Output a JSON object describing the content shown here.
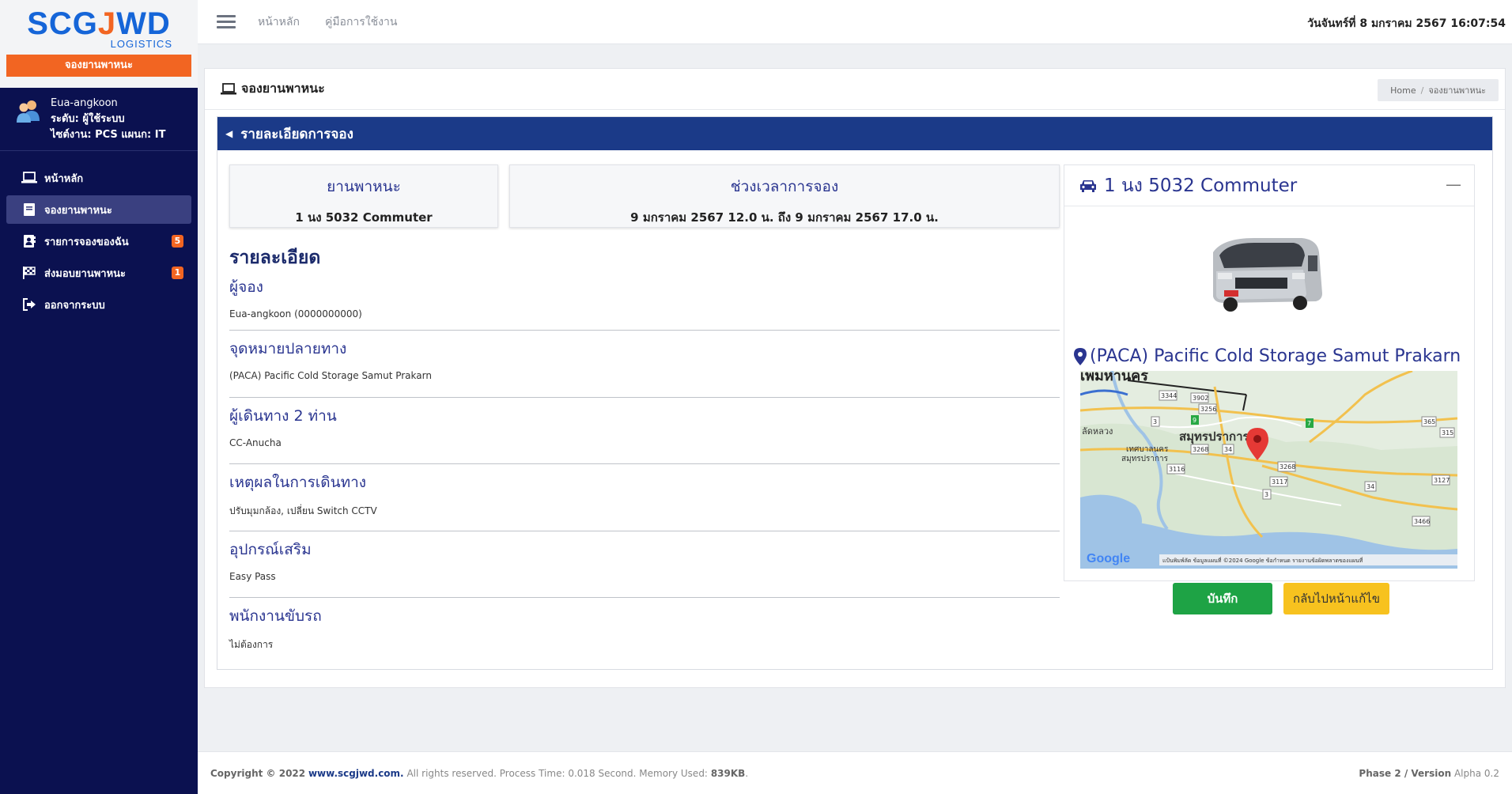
{
  "sidebar": {
    "logo_main": "SCGJWD",
    "logo_sub": "LOGISTICS",
    "logo_banner": "จองยานพาหนะ",
    "user": {
      "name": "Eua-angkoon",
      "role": "ระดับ: ผู้ใช้ระบบ",
      "site": "ไซต์งาน: PCS แผนก: IT"
    },
    "items": [
      {
        "label": "หน้าหลัก",
        "icon": "laptop-icon"
      },
      {
        "label": "จองยานพาหนะ",
        "icon": "book-icon",
        "active": true
      },
      {
        "label": "รายการจองของฉัน",
        "icon": "contact-book-icon",
        "badge": "5"
      },
      {
        "label": "ส่งมอบยานพาหนะ",
        "icon": "flag-checkered-icon",
        "badge": "1"
      },
      {
        "label": "ออกจากระบบ",
        "icon": "sign-out-icon"
      }
    ]
  },
  "topbar": {
    "links": [
      "หน้าหลัก",
      "คู่มือการใช้งาน"
    ],
    "datetime": "วันจันทร์ที่ 8 มกราคม 2567  16:07:54"
  },
  "page": {
    "title": "จองยานพาหนะ",
    "breadcrumb": [
      "Home",
      "จองยานพาหนะ"
    ]
  },
  "panel": {
    "header": "รายละเอียดการจอง",
    "vehicle_box": {
      "label": "ยานพาหนะ",
      "value": "1 นง 5032 Commuter"
    },
    "time_box": {
      "label": "ช่วงเวลาการจอง",
      "value": "9 มกราคม 2567 12.0 น. ถึง 9 มกราคม 2567 17.0 น."
    },
    "details_title": "รายละเอียด",
    "fields": [
      {
        "label": "ผู้จอง",
        "value": "Eua-angkoon (0000000000)"
      },
      {
        "label": "จุดหมายปลายทาง",
        "value": "(PACA) Pacific Cold Storage Samut Prakarn"
      },
      {
        "label": "ผู้เดินทาง 2 ท่าน",
        "value": "CC-Anucha"
      },
      {
        "label": "เหตุผลในการเดินทาง",
        "value": "ปรับมุมกล้อง, เปลี่ยน Switch CCTV"
      },
      {
        "label": "อุปกรณ์เสริม",
        "value": "Easy Pass"
      },
      {
        "label": "พนักงานขับรถ",
        "value": "ไม่ต้องการ"
      }
    ],
    "vehicle_card": {
      "title": "1 นง 5032 Commuter",
      "destination": "(PACA) Pacific Cold Storage Samut Prakarn",
      "map": {
        "city_label_top": "เพมหานคร",
        "city_label_main": "สมุทรปราการ",
        "town_label_1": "ลัดหลวง",
        "town_label_2": "เทศบาลนคร",
        "town_label_3": "สมุทรปราการ",
        "attribution": "แป้นพิมพ์ลัด   ข้อมูลแผนที่ ©2024 Google   ข้อกำหนด   รายงานข้อผิดพลาดของแผนที่",
        "google_label": "Google",
        "road_numbers": [
          "3344",
          "3902",
          "3256",
          "3",
          "9",
          "7",
          "3268",
          "34",
          "3116",
          "3268",
          "3117",
          "34",
          "3",
          "3127",
          "3466",
          "315",
          "365"
        ]
      }
    },
    "buttons": {
      "save": "บันทึก",
      "back": "กลับไปหน้าแก้ไข"
    }
  },
  "footer": {
    "copyright_prefix": "Copyright © 2022",
    "site": "www.scgjwd.com.",
    "rights": "All rights reserved. Process Time: 0.018 Second. Memory Used:",
    "memory": "839KB",
    "version_label": "Phase 2 / Version",
    "version": "Alpha 0.2"
  },
  "colors": {
    "sidebar_bg": "#0b1150",
    "brand_orange": "#f26522",
    "brand_blue": "#1565d8",
    "panel_header": "#1b3a88",
    "save_green": "#1ea345",
    "back_yellow": "#f7c21f"
  }
}
